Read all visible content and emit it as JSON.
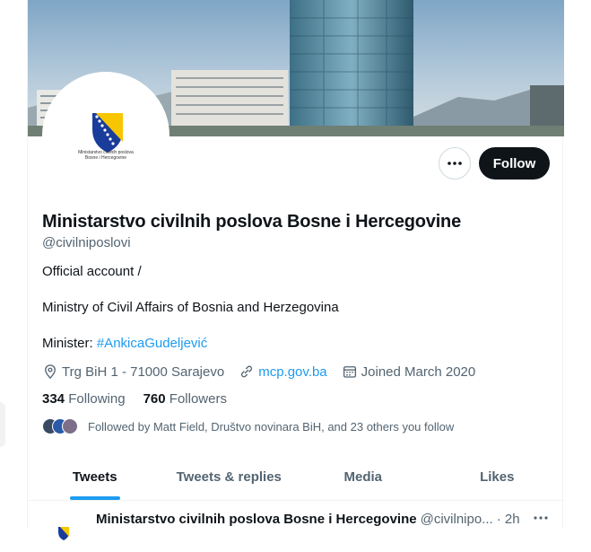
{
  "profile": {
    "display_name": "Ministarstvo civilnih poslova Bosne i Hercegovine",
    "handle": "@civilniposlovi",
    "avatar_caption_line1": "Ministarstvo civilnih poslova",
    "avatar_caption_line2": "Bosne i Hercegovine",
    "bio_line1": "Official account /",
    "bio_line2": "Ministry of Civil Affairs of Bosnia and Herzegovina",
    "bio_line3_prefix": "Minister: ",
    "bio_line3_hashtag": "#AnkicaGudeljević",
    "location": "Trg BiH 1 - 71000 Sarajevo",
    "website": "mcp.gov.ba",
    "joined": "Joined March 2020",
    "following_count": "334",
    "following_label": "Following",
    "followers_count": "760",
    "followers_label": "Followers",
    "followed_by": "Followed by Matt Field, Društvo novinara BiH, and 23 others you follow"
  },
  "actions": {
    "follow_label": "Follow",
    "more_icon": "more-horizontal-icon"
  },
  "tabs": [
    {
      "label": "Tweets"
    },
    {
      "label": "Tweets & replies"
    },
    {
      "label": "Media"
    },
    {
      "label": "Likes"
    }
  ],
  "tweet": {
    "name": "Ministarstvo civilnih poslova Bosne i Hercegovine",
    "handle": "@civilnipo...",
    "time": "· 2h"
  },
  "colors": {
    "accent": "#1d9bf0",
    "text": "#0f1419",
    "secondary": "#536471",
    "button_dark": "#0f1419"
  }
}
